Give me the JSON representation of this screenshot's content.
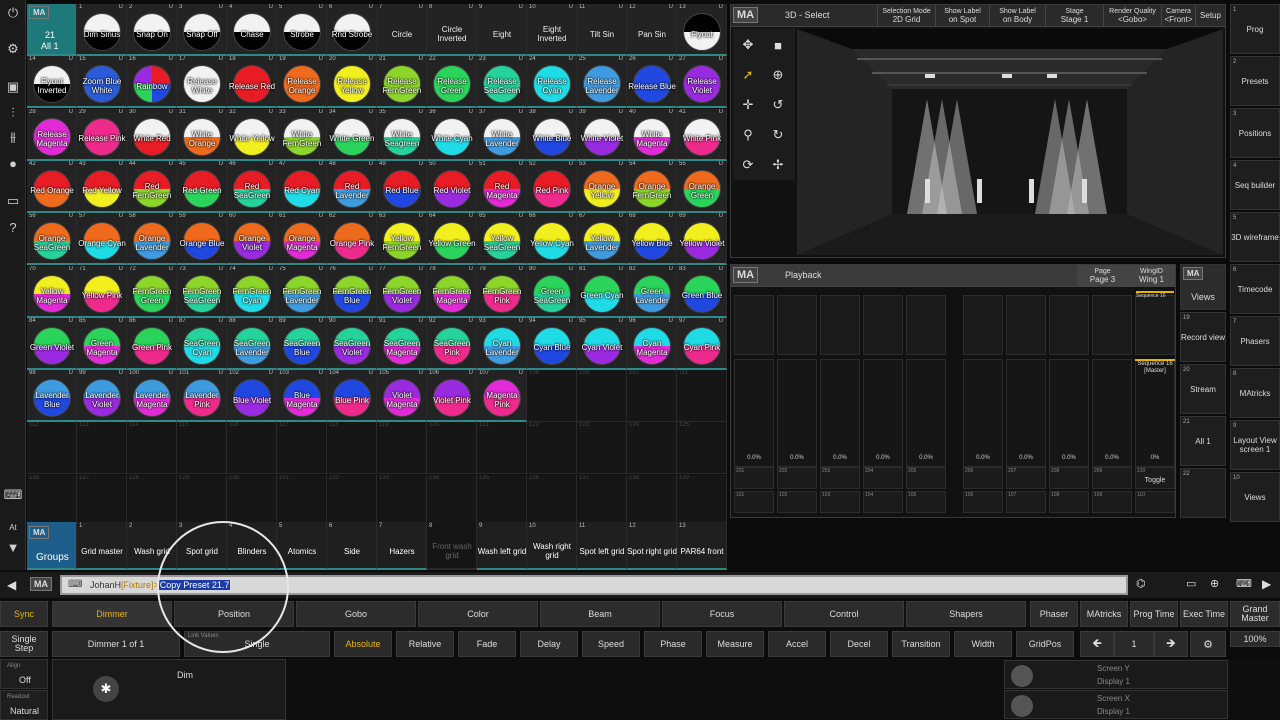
{
  "topbar": {
    "power_icon": "power-icon"
  },
  "grid_header": {
    "ma": "MA",
    "num": "21",
    "label": "All 1"
  },
  "presets": [
    {
      "n": "1",
      "l": "Dim Sinus",
      "c": "split"
    },
    {
      "n": "2",
      "l": "Snap On",
      "c": "split"
    },
    {
      "n": "3",
      "l": "Snap Off",
      "c": "split"
    },
    {
      "n": "4",
      "l": "Chase",
      "c": "split"
    },
    {
      "n": "5",
      "l": "Strobe",
      "c": "split"
    },
    {
      "n": "6",
      "l": "Rnd Strobe",
      "c": "split"
    },
    {
      "n": "7",
      "l": "Circle",
      "c": ""
    },
    {
      "n": "8",
      "l": "Circle Inverted",
      "c": ""
    },
    {
      "n": "9",
      "l": "Eight",
      "c": ""
    },
    {
      "n": "10",
      "l": "Eight Inverted",
      "c": ""
    },
    {
      "n": "11",
      "l": "Tilt Sin",
      "c": ""
    },
    {
      "n": "12",
      "l": "Pan Sin",
      "c": ""
    },
    {
      "n": "13",
      "l": "Flyout",
      "c": "splitinv"
    },
    {
      "n": "14",
      "l": "Flyout Inverted",
      "c": "splitinv2"
    },
    {
      "n": "15",
      "l": "Zoom Blue White",
      "c": "#2a5bd8"
    },
    {
      "n": "16",
      "l": "Rainbow",
      "c": "rainbow"
    },
    {
      "n": "17",
      "l": "Release White",
      "c": "#f2f2f2"
    },
    {
      "n": "18",
      "l": "Release Red",
      "c": "#e81c24"
    },
    {
      "n": "19",
      "l": "Release Orange",
      "c": "#ef6a1d"
    },
    {
      "n": "20",
      "l": "Release Yellow",
      "c": "#f2ef1e"
    },
    {
      "n": "21",
      "l": "Release FernGreen",
      "c": "#8cd62a"
    },
    {
      "n": "22",
      "l": "Release Green",
      "c": "#2ad45a"
    },
    {
      "n": "23",
      "l": "Release SeaGreen",
      "c": "#25d39a"
    },
    {
      "n": "24",
      "l": "Release Cyan",
      "c": "#1fdbe6"
    },
    {
      "n": "25",
      "l": "Release Lavender",
      "c": "#3f9be0"
    },
    {
      "n": "26",
      "l": "Release Blue",
      "c": "#2048e0"
    },
    {
      "n": "27",
      "l": "Release Violet",
      "c": "#9a2ae0"
    },
    {
      "n": "28",
      "l": "Release Magenta",
      "c": "#e22ad6"
    },
    {
      "n": "29",
      "l": "Release Pink",
      "c": "#ee2a8c"
    },
    {
      "n": "30",
      "l": "White Red",
      "c": "wr"
    },
    {
      "n": "31",
      "l": "White Orange",
      "c": "wo"
    },
    {
      "n": "32",
      "l": "White Yellow",
      "c": "wy"
    },
    {
      "n": "33",
      "l": "White FernGreen",
      "c": "wf"
    },
    {
      "n": "34",
      "l": "White Green",
      "c": "wg"
    },
    {
      "n": "35",
      "l": "White Seagreen",
      "c": "ws"
    },
    {
      "n": "36",
      "l": "White Cyan",
      "c": "wc"
    },
    {
      "n": "37",
      "l": "White Lavender",
      "c": "wl"
    },
    {
      "n": "38",
      "l": "White Blue",
      "c": "wb"
    },
    {
      "n": "39",
      "l": "White Violet",
      "c": "wv"
    },
    {
      "n": "40",
      "l": "White Magenta",
      "c": "wm"
    },
    {
      "n": "41",
      "l": "White Pink",
      "c": "wp"
    },
    {
      "n": "42",
      "l": "Red Orange",
      "c": "#e81c24|#ef6a1d"
    },
    {
      "n": "43",
      "l": "Red Yellow",
      "c": "#e81c24|#f2ef1e"
    },
    {
      "n": "44",
      "l": "Red FernGreen",
      "c": "#e81c24|#8cd62a"
    },
    {
      "n": "45",
      "l": "Red Green",
      "c": "#e81c24|#2ad45a"
    },
    {
      "n": "46",
      "l": "Red SeaGreen",
      "c": "#e81c24|#25d39a"
    },
    {
      "n": "47",
      "l": "Red Cyan",
      "c": "#e81c24|#1fdbe6"
    },
    {
      "n": "48",
      "l": "Red Lavender",
      "c": "#e81c24|#3f9be0"
    },
    {
      "n": "49",
      "l": "Red Blue",
      "c": "#e81c24|#2048e0"
    },
    {
      "n": "50",
      "l": "Red Violet",
      "c": "#e81c24|#9a2ae0"
    },
    {
      "n": "51",
      "l": "Red Magenta",
      "c": "#e81c24|#e22ad6"
    },
    {
      "n": "52",
      "l": "Red Pink",
      "c": "#e81c24|#ee2a8c"
    },
    {
      "n": "53",
      "l": "Orange Yellow",
      "c": "#ef6a1d|#f2ef1e"
    },
    {
      "n": "54",
      "l": "Orange FernGreen",
      "c": "#ef6a1d|#8cd62a"
    },
    {
      "n": "55",
      "l": "Orange Green",
      "c": "#ef6a1d|#2ad45a"
    },
    {
      "n": "56",
      "l": "Orange SeaGreen",
      "c": "#ef6a1d|#25d39a"
    },
    {
      "n": "57",
      "l": "Orange Cyan",
      "c": "#ef6a1d|#1fdbe6"
    },
    {
      "n": "58",
      "l": "Orange Lavender",
      "c": "#ef6a1d|#3f9be0"
    },
    {
      "n": "59",
      "l": "Orange Blue",
      "c": "#ef6a1d|#2048e0"
    },
    {
      "n": "60",
      "l": "Orange Violet",
      "c": "#ef6a1d|#9a2ae0"
    },
    {
      "n": "61",
      "l": "Orange Magenta",
      "c": "#ef6a1d|#e22ad6"
    },
    {
      "n": "62",
      "l": "Orange Pink",
      "c": "#ef6a1d|#ee2a8c"
    },
    {
      "n": "63",
      "l": "Yellow FernGreen",
      "c": "#f2ef1e|#8cd62a"
    },
    {
      "n": "64",
      "l": "Yellow Green",
      "c": "#f2ef1e|#2ad45a"
    },
    {
      "n": "65",
      "l": "Yellow SeaGreen",
      "c": "#f2ef1e|#25d39a"
    },
    {
      "n": "66",
      "l": "Yellow Cyan",
      "c": "#f2ef1e|#1fdbe6"
    },
    {
      "n": "67",
      "l": "Yellow Lavender",
      "c": "#f2ef1e|#3f9be0"
    },
    {
      "n": "68",
      "l": "Yellow Blue",
      "c": "#f2ef1e|#2048e0"
    },
    {
      "n": "69",
      "l": "Yellow Violet",
      "c": "#f2ef1e|#9a2ae0"
    },
    {
      "n": "70",
      "l": "Yellow Magenta",
      "c": "#f2ef1e|#e22ad6"
    },
    {
      "n": "71",
      "l": "Yellow Pink",
      "c": "#f2ef1e|#ee2a8c"
    },
    {
      "n": "72",
      "l": "FernGreen Green",
      "c": "#8cd62a|#2ad45a"
    },
    {
      "n": "73",
      "l": "FernGreen SeaGreen",
      "c": "#8cd62a|#25d39a"
    },
    {
      "n": "74",
      "l": "FernGreen Cyan",
      "c": "#8cd62a|#1fdbe6"
    },
    {
      "n": "75",
      "l": "FernGreen Lavender",
      "c": "#8cd62a|#3f9be0"
    },
    {
      "n": "76",
      "l": "FernGreen Blue",
      "c": "#8cd62a|#2048e0"
    },
    {
      "n": "77",
      "l": "FernGreen Violet",
      "c": "#8cd62a|#9a2ae0"
    },
    {
      "n": "78",
      "l": "FernGreen Magenta",
      "c": "#8cd62a|#e22ad6"
    },
    {
      "n": "79",
      "l": "FernGreen Pink",
      "c": "#8cd62a|#ee2a8c"
    },
    {
      "n": "80",
      "l": "Green SeaGreen",
      "c": "#2ad45a|#25d39a"
    },
    {
      "n": "81",
      "l": "Green Cyan",
      "c": "#2ad45a|#1fdbe6"
    },
    {
      "n": "82",
      "l": "Green Lavender",
      "c": "#2ad45a|#3f9be0"
    },
    {
      "n": "83",
      "l": "Green Blue",
      "c": "#2ad45a|#2048e0"
    },
    {
      "n": "84",
      "l": "Green Violet",
      "c": "#2ad45a|#9a2ae0"
    },
    {
      "n": "85",
      "l": "Green Magenta",
      "c": "#2ad45a|#e22ad6"
    },
    {
      "n": "86",
      "l": "Green Pink",
      "c": "#2ad45a|#ee2a8c"
    },
    {
      "n": "87",
      "l": "SeaGreen Cyan",
      "c": "#25d39a|#1fdbe6"
    },
    {
      "n": "88",
      "l": "SeaGreen Lavender",
      "c": "#25d39a|#3f9be0"
    },
    {
      "n": "89",
      "l": "SeaGreen Blue",
      "c": "#25d39a|#2048e0"
    },
    {
      "n": "90",
      "l": "SeaGreen Violet",
      "c": "#25d39a|#9a2ae0"
    },
    {
      "n": "91",
      "l": "SeaGreen Magenta",
      "c": "#25d39a|#e22ad6"
    },
    {
      "n": "92",
      "l": "SeaGreen Pink",
      "c": "#25d39a|#ee2a8c"
    },
    {
      "n": "93",
      "l": "Cyan Lavender",
      "c": "#1fdbe6|#3f9be0"
    },
    {
      "n": "94",
      "l": "Cyan Blue",
      "c": "#1fdbe6|#2048e0"
    },
    {
      "n": "95",
      "l": "Cyan Violet",
      "c": "#1fdbe6|#9a2ae0"
    },
    {
      "n": "96",
      "l": "Cyan Magenta",
      "c": "#1fdbe6|#e22ad6"
    },
    {
      "n": "97",
      "l": "Cyan Pink",
      "c": "#1fdbe6|#ee2a8c"
    },
    {
      "n": "98",
      "l": "Lavender Blue",
      "c": "#3f9be0|#2048e0"
    },
    {
      "n": "99",
      "l": "Lavender Violet",
      "c": "#3f9be0|#9a2ae0"
    },
    {
      "n": "100",
      "l": "Lavender Magenta",
      "c": "#3f9be0|#e22ad6"
    },
    {
      "n": "101",
      "l": "Lavender Pink",
      "c": "#3f9be0|#ee2a8c"
    },
    {
      "n": "102",
      "l": "Blue Violet",
      "c": "#2048e0|#9a2ae0"
    },
    {
      "n": "103",
      "l": "Blue Magenta",
      "c": "#2048e0|#e22ad6"
    },
    {
      "n": "104",
      "l": "Blue Pink",
      "c": "#2048e0|#ee2a8c"
    },
    {
      "n": "105",
      "l": "Violet Magenta",
      "c": "#9a2ae0|#e22ad6"
    },
    {
      "n": "106",
      "l": "Violet Pink",
      "c": "#9a2ae0|#ee2a8c"
    },
    {
      "n": "107",
      "l": "Magenta Pink",
      "c": "#e22ad6|#ee2a8c"
    }
  ],
  "empty_start": 108,
  "empty_end": 140,
  "groups": {
    "ma": "MA",
    "title": "Groups",
    "items": [
      {
        "n": "1",
        "l": "Grid master"
      },
      {
        "n": "2",
        "l": "Wash grid"
      },
      {
        "n": "3",
        "l": "Spot grid"
      },
      {
        "n": "4",
        "l": "Blinders"
      },
      {
        "n": "5",
        "l": "Atomics"
      },
      {
        "n": "6",
        "l": "Side"
      },
      {
        "n": "7",
        "l": "Hazers"
      },
      {
        "n": "8",
        "l": "Front wash grid",
        "dim": true
      },
      {
        "n": "9",
        "l": "Wash left grid"
      },
      {
        "n": "10",
        "l": "Wash right grid"
      },
      {
        "n": "11",
        "l": "Spot left grid"
      },
      {
        "n": "12",
        "l": "Spot right grid"
      },
      {
        "n": "13",
        "l": "PAR64 front"
      }
    ]
  },
  "view3d": {
    "ma": "MA",
    "title": "3D - Select",
    "buttons": [
      {
        "t": "Selection Mode",
        "v": "2D Grid"
      },
      {
        "t": "Show Label",
        "v": "on Spot"
      },
      {
        "t": "Show Label",
        "v": "on Body"
      },
      {
        "t": "Stage",
        "v": "Stage 1"
      },
      {
        "t": "Render Quality",
        "v": "<Gobo>"
      },
      {
        "t": "Camera",
        "v": "<Front>"
      },
      {
        "t": "",
        "v": "Setup"
      }
    ]
  },
  "playback": {
    "ma": "MA",
    "title": "Playback",
    "page_label": "Page",
    "page": "Page 3",
    "wing_label": "WingID",
    "wing": "Wing 1",
    "seq_top": "Sequence 16",
    "seq_master": "Sequence 16 [Master]",
    "values": [
      "0.0%",
      "0.0%",
      "0.0%",
      "0.0%",
      "0.0%",
      "0.0%",
      "0.0%",
      "0.0%",
      "0.0%",
      "0%"
    ],
    "nums1": [
      "201",
      "202",
      "203",
      "204",
      "205",
      "206",
      "207",
      "208",
      "209",
      "210"
    ],
    "nums2": [
      "101",
      "102",
      "103",
      "104",
      "105",
      "106",
      "107",
      "108",
      "109",
      "110"
    ],
    "toggle": "Toggle"
  },
  "views": {
    "ma": "MA",
    "title": "Views",
    "items": [
      {
        "n": "19",
        "l": "Record view"
      },
      {
        "n": "20",
        "l": "Stream"
      },
      {
        "n": "21",
        "l": "All 1"
      },
      {
        "n": "22",
        "l": ""
      }
    ]
  },
  "rightbar": [
    {
      "n": "1",
      "l": "Prog"
    },
    {
      "n": "2",
      "l": "Presets"
    },
    {
      "n": "3",
      "l": "Positions"
    },
    {
      "n": "4",
      "l": "Seq builder"
    },
    {
      "n": "5",
      "l": "3D wireframe"
    },
    {
      "n": "6",
      "l": "Timecode"
    },
    {
      "n": "7",
      "l": "Phasers"
    },
    {
      "n": "8",
      "l": "MAtricks"
    },
    {
      "n": "9",
      "l": "Layout View screen 1"
    },
    {
      "n": "10",
      "l": "Views"
    }
  ],
  "cmdline": {
    "ma": "MA",
    "user": "JohanH",
    "fixture": "[Fixture]>",
    "command": "Copy Preset 21.7"
  },
  "features": [
    {
      "l": "Sync"
    },
    {
      "l": "Dimmer",
      "active": true
    },
    {
      "l": "Position"
    },
    {
      "l": "Gobo"
    },
    {
      "l": "Color"
    },
    {
      "l": "Beam"
    },
    {
      "l": "Focus"
    },
    {
      "l": "Control"
    },
    {
      "l": "Shapers"
    },
    {
      "l": "Phaser"
    },
    {
      "l": "MAtricks"
    },
    {
      "l": "Prog Time"
    },
    {
      "l": "Exec Time"
    },
    {
      "l": "Grand Master"
    }
  ],
  "attrs": [
    {
      "l": "Single Step"
    },
    {
      "l": "Dimmer 1 of 1"
    },
    {
      "l": "Single"
    },
    {
      "l": "Absolute",
      "active": true
    },
    {
      "l": "Relative"
    },
    {
      "l": "Fade"
    },
    {
      "l": "Delay"
    },
    {
      "l": "Speed"
    },
    {
      "l": "Phase"
    },
    {
      "l": "Measure"
    },
    {
      "l": "Accel"
    },
    {
      "l": "Decel"
    },
    {
      "l": "Transition"
    },
    {
      "l": "Width"
    },
    {
      "l": "GridPos"
    }
  ],
  "link_values": "Link Values",
  "grand_value": "100%",
  "step": "1",
  "bottom": {
    "align": "Align",
    "align_val": "Off",
    "readout": "Readout",
    "readout_val": "Natural",
    "dim": "Dim",
    "screeny": "Screen Y",
    "display1": "Display 1",
    "screenx": "Screen X",
    "display2": "Display 1"
  }
}
